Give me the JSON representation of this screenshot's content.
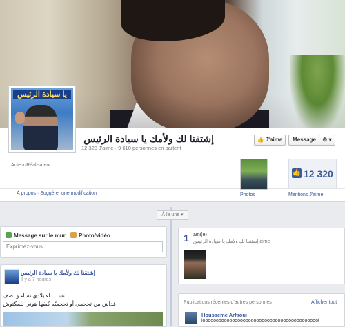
{
  "page": {
    "name": "إشتقنا لك ولأمك يا سيادة الرئيس",
    "stats": "12 320 J'aime · 9 610 personnes en parlent",
    "category": "Acteur/Réalisateur",
    "profile_banner": "يا سيادة الرئيس"
  },
  "actions": {
    "like_label": "J'aime",
    "message_label": "Message",
    "gear_label": "⚙ ▾"
  },
  "about": {
    "link": "À propos",
    "separator": " · ",
    "suggest": "Suggérer une modification"
  },
  "apps": {
    "photos_label": "Photos",
    "likes_label": "Mentions J'aime",
    "likes_count": "12 320"
  },
  "timeline": {
    "year_pill": "À la une ▾"
  },
  "composer": {
    "tab_status": "Message sur le mur",
    "tab_photo": "Photo/vidéo",
    "placeholder": "Exprimez-vous"
  },
  "post": {
    "author": "إشتقنا لك ولأمك يا سيادة الرئيس",
    "time": "Il y a 7 heures",
    "line1": "نســـــاء بلادي نساء و نصف",
    "line2": "قداش من تحجمي أو تحجميّه كيفها هوني للمكتوش"
  },
  "friends": {
    "count": "1",
    "label": "ami(e)",
    "sub": "aime إشتقنا لك ولأمك يا سيادة الرئيس"
  },
  "recent": {
    "title": "Publications récentes d'autres personnes",
    "see_all": "Afficher tout",
    "author": "Housseme Arfaoui",
    "text": "loooooooooooooooooooooooooooooooooooooooooool"
  },
  "colors": {
    "brand": "#3b5998",
    "background": "#e9ebee"
  }
}
